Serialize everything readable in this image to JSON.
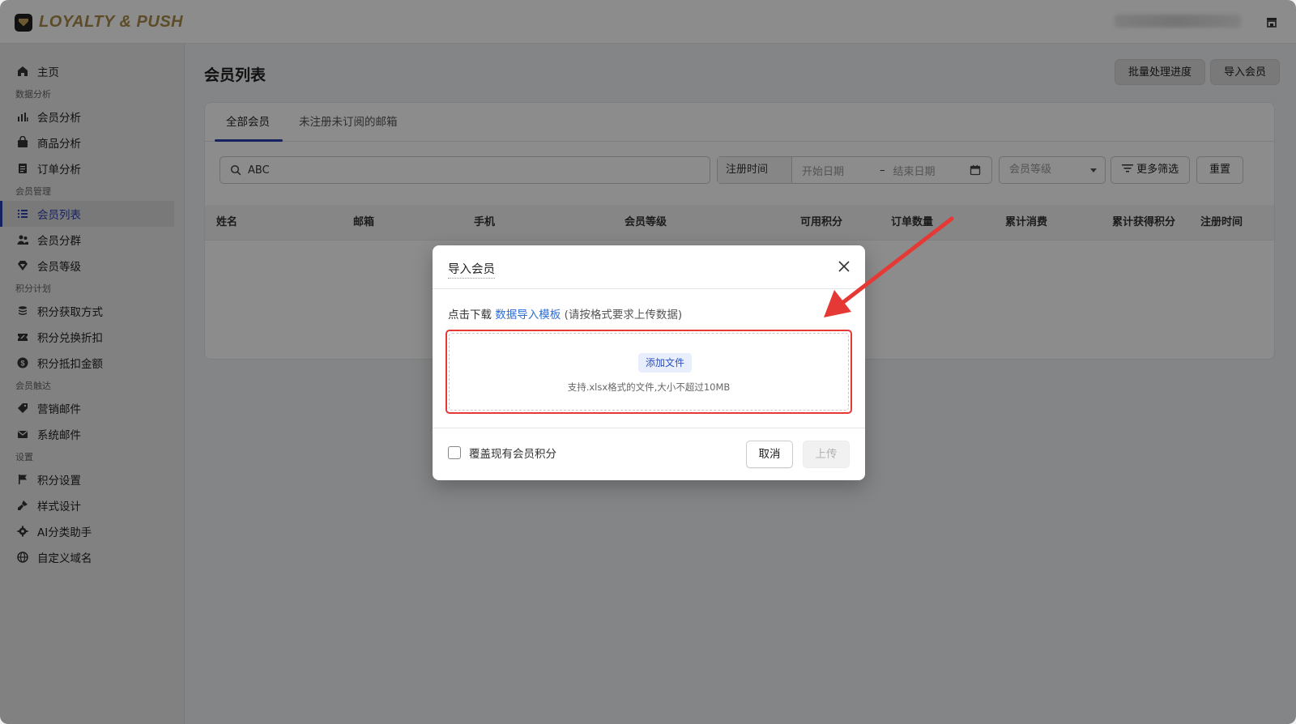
{
  "app": {
    "logo_text": "LOYALTY & PUSH"
  },
  "sidebar": {
    "home": "主页",
    "groups": [
      {
        "label": "数据分析",
        "items": [
          "会员分析",
          "商品分析",
          "订单分析"
        ]
      },
      {
        "label": "会员管理",
        "items": [
          "会员列表",
          "会员分群",
          "会员等级"
        ]
      },
      {
        "label": "积分计划",
        "items": [
          "积分获取方式",
          "积分兑换折扣",
          "积分抵扣金额"
        ]
      },
      {
        "label": "会员触达",
        "items": [
          "营销邮件",
          "系统邮件"
        ]
      },
      {
        "label": "设置",
        "items": [
          "积分设置",
          "样式设计",
          "AI分类助手",
          "自定义域名"
        ]
      }
    ],
    "active_item": "会员列表"
  },
  "page": {
    "title": "会员列表",
    "batch_progress_button": "批量处理进度",
    "import_button": "导入会员"
  },
  "tabs": [
    "全部会员",
    "未注册未订阅的邮箱"
  ],
  "filters": {
    "search_value": "ABC",
    "date_label": "注册时间",
    "start_placeholder": "开始日期",
    "separator": "–",
    "end_placeholder": "结束日期",
    "level_placeholder": "会员等级",
    "more_filters": "更多筛选",
    "reset": "重置"
  },
  "table": {
    "columns": [
      "姓名",
      "邮箱",
      "手机",
      "会员等级",
      "可用积分",
      "订单数量",
      "累计消费",
      "累计获得积分",
      "注册时间"
    ]
  },
  "modal": {
    "title": "导入会员",
    "tip_prefix": "点击下载",
    "tip_link": "数据导入模板",
    "tip_suffix": "(请按格式要求上传数据)",
    "add_file": "添加文件",
    "hint": "支持.xlsx格式的文件,大小不超过10MB",
    "overwrite_label": "覆盖现有会员积分",
    "cancel": "取消",
    "upload": "上传"
  },
  "colors": {
    "accent": "#2b3fb0",
    "link": "#2c6ed5",
    "highlight": "#e53935",
    "logo": "#a98a49"
  }
}
